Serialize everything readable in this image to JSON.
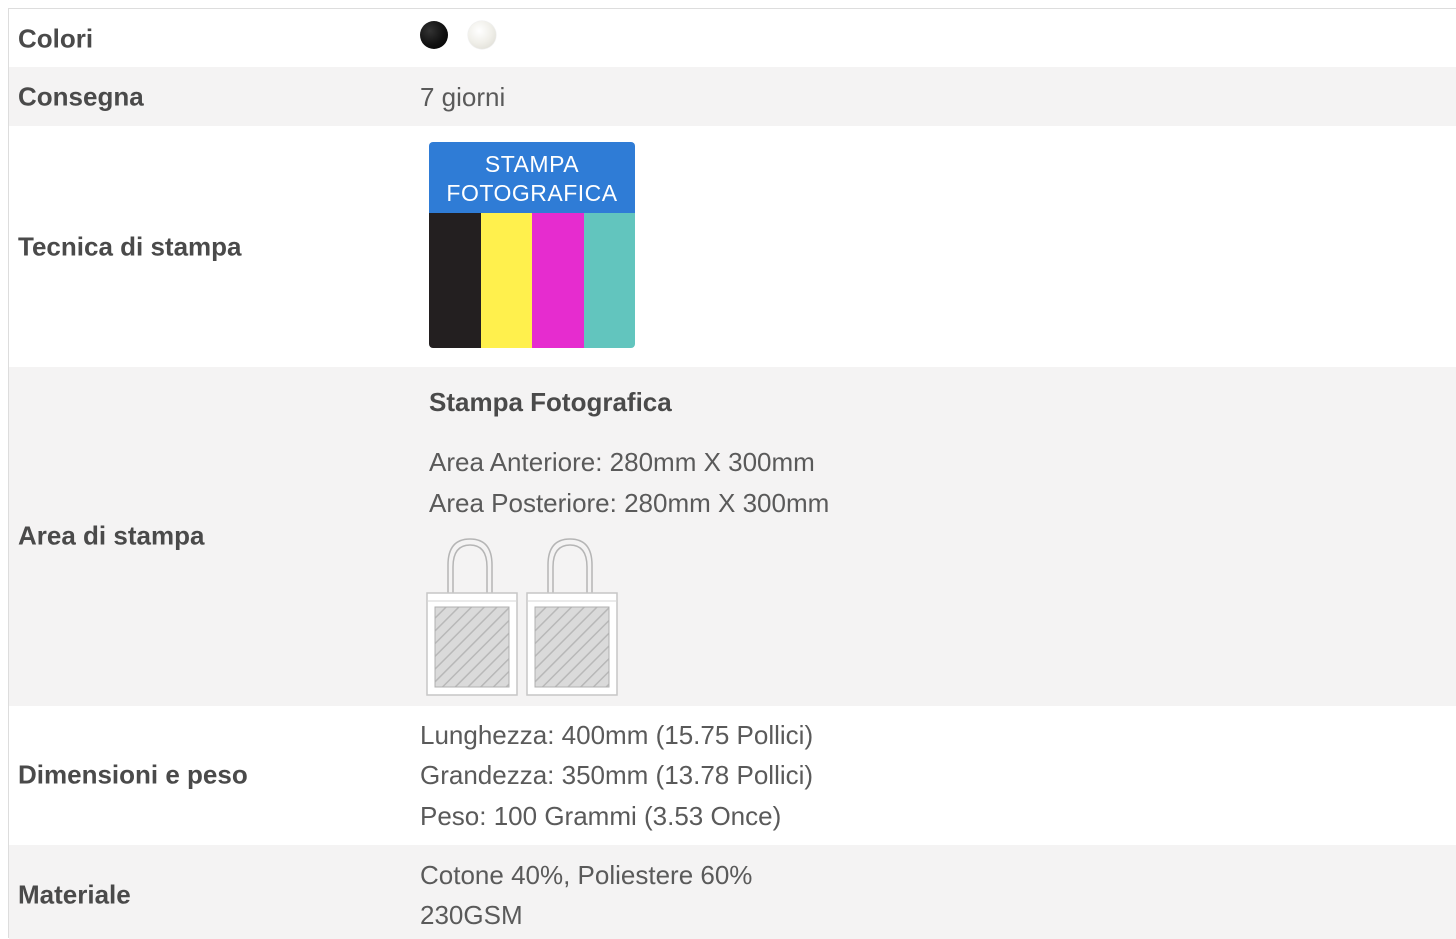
{
  "rows": {
    "colors": {
      "label": "Colori",
      "swatches": [
        {
          "name": "black",
          "color": "#111111"
        },
        {
          "name": "natural",
          "color": "#f0efe9"
        }
      ]
    },
    "delivery": {
      "label": "Consegna",
      "value": "7 giorni"
    },
    "technique": {
      "label": "Tecnica di stampa",
      "badge": {
        "line1": "STAMPA",
        "line2": "FOTOGRAFICA",
        "header_color": "#2f7cd6",
        "bars": [
          "#231f20",
          "#fff04d",
          "#e62ccf",
          "#62c5be"
        ]
      }
    },
    "print_area": {
      "label": "Area di stampa",
      "title": "Stampa Fotografica",
      "front": "Area Anteriore: 280mm X 300mm",
      "back": "Area Posteriore: 280mm X 300mm",
      "images": [
        "front-bag-diagram",
        "back-bag-diagram"
      ]
    },
    "dimensions": {
      "label": "Dimensioni e peso",
      "length": "Lunghezza: 400mm (15.75 Pollici)",
      "width": "Grandezza: 350mm (13.78 Pollici)",
      "weight": "Peso: 100 Grammi (3.53 Once)"
    },
    "material": {
      "label": "Materiale",
      "line1": "Cotone 40%, Poliestere 60%",
      "line2": "230GSM"
    }
  }
}
